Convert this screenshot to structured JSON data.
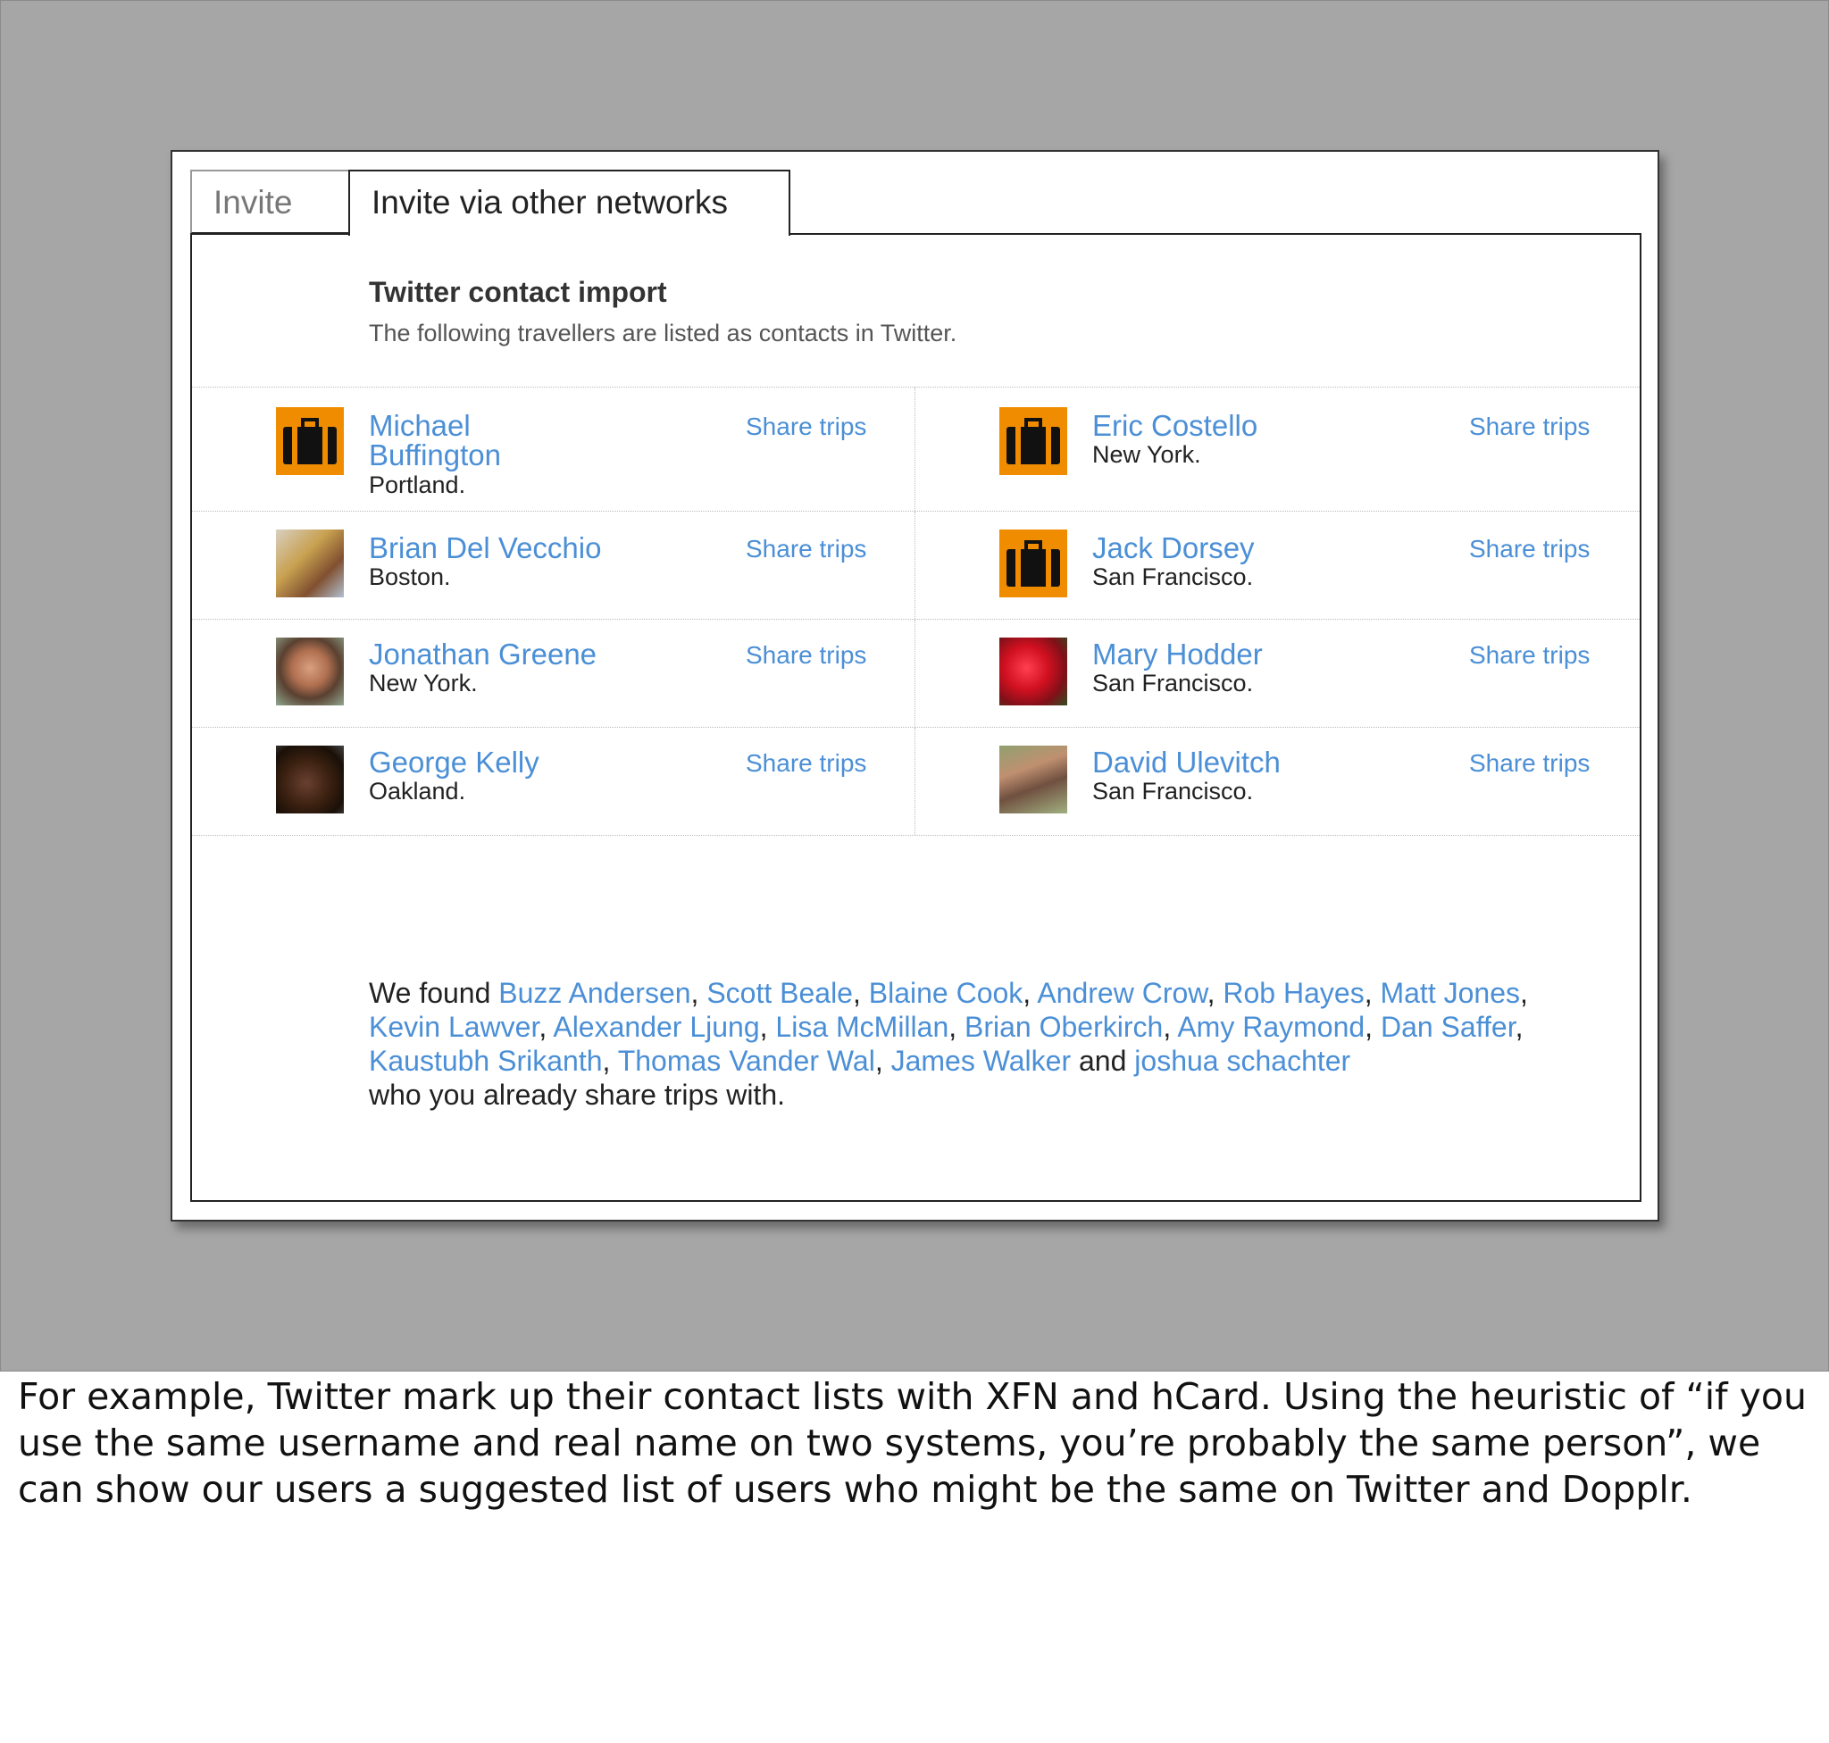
{
  "tabs": [
    {
      "label": "Invite"
    },
    {
      "label": "Invite via other networks"
    }
  ],
  "panel": {
    "title": "Twitter contact import",
    "subtitle": "The following travellers are listed as contacts in Twitter."
  },
  "share_label": "Share trips",
  "contacts": [
    {
      "name_line1": "Michael",
      "name_line2": "Buffington",
      "city": "Portland.",
      "avatar": "suitcase-icon"
    },
    {
      "name_line1": "Eric Costello",
      "city": "New York.",
      "avatar": "suitcase-icon"
    },
    {
      "name_line1": "Brian Del Vecchio",
      "city": "Boston.",
      "avatar": "photo"
    },
    {
      "name_line1": "Jack Dorsey",
      "city": "San Francisco.",
      "avatar": "suitcase-icon"
    },
    {
      "name_line1": "Jonathan Greene",
      "city": "New York.",
      "avatar": "photo"
    },
    {
      "name_line1": "Mary Hodder",
      "city": "San Francisco.",
      "avatar": "photo"
    },
    {
      "name_line1": "George Kelly",
      "city": "Oakland.",
      "avatar": "photo"
    },
    {
      "name_line1": "David Ulevitch",
      "city": "San Francisco.",
      "avatar": "photo"
    }
  ],
  "found": {
    "prefix": "We found",
    "names": [
      "Buzz Andersen",
      "Scott Beale",
      "Blaine Cook",
      "Andrew Crow",
      "Rob Hayes",
      "Matt Jones",
      "Kevin Lawver",
      "Alexander Ljung",
      "Lisa McMillan",
      "Brian Oberkirch",
      "Amy Raymond",
      "Dan Saffer",
      "Kaustubh Srikanth",
      "Thomas Vander Wal",
      "James Walker"
    ],
    "and": "and",
    "last": "joshua schachter",
    "suffix": "who you already share trips with."
  },
  "caption": "For example, Twitter mark up their contact lists with XFN and hCard. Using the heuristic of “if you use the same username and real name on two systems, you’re probably the same person”, we can show our users a suggested list of users who might be the same on Twitter and Dopplr."
}
